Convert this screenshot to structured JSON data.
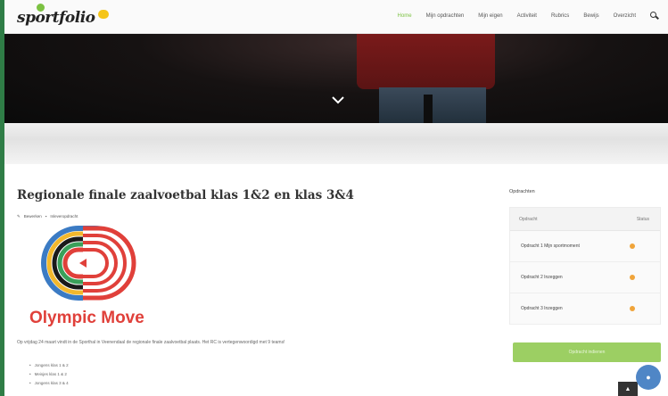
{
  "header": {
    "logo_text": "sportfolio",
    "nav": [
      {
        "label": "Home",
        "active": true
      },
      {
        "label": "Mijn opdrachten",
        "active": false
      },
      {
        "label": "Mijn eigen",
        "active": false
      },
      {
        "label": "Activiteit",
        "active": false
      },
      {
        "label": "Rubrics",
        "active": false
      },
      {
        "label": "Bewijs",
        "active": false
      },
      {
        "label": "Overzicht",
        "active": false
      }
    ]
  },
  "article": {
    "title": "Regionale finale zaalvoetbal klas 1&2 en klas 3&4",
    "meta_author": "Bewerken",
    "meta_category": "Inleveropdracht",
    "logo_text": "Olympic Moves",
    "intro": "Op vrijdag 24 maart vindt in de Sporthal in Veenendaal de regionale finale zaalvoetbal plaats. Het RC is vertegenwoordigd met 9 teams!",
    "bullets": [
      "Jongens klas 1 & 2",
      "Meisjes klas 1 & 2",
      "Jongens klas 3 & 4"
    ]
  },
  "sidebar": {
    "heading": "Opdrachten",
    "col_task": "Opdracht",
    "col_status": "Status",
    "rows": [
      {
        "label": "Opdracht 1 Mijn sportmoment",
        "status_color": "#f0a43a"
      },
      {
        "label": "Opdracht 2 Inzeggen",
        "status_color": "#f0a43a"
      },
      {
        "label": "Opdracht 3 Inzeggen",
        "status_color": "#f0a43a"
      }
    ],
    "button_label": "Opdracht indienen"
  },
  "colors": {
    "accent_green": "#7cc242",
    "button_green": "#9ccf63",
    "frame_green": "#2f7d46",
    "status_orange": "#f0a43a",
    "chat_blue": "#4f86c6"
  },
  "icons": {
    "search": "search-icon",
    "hero": "chevron-down-icon",
    "chat": "chat-icon",
    "scroll_top": "chevron-up-icon"
  }
}
